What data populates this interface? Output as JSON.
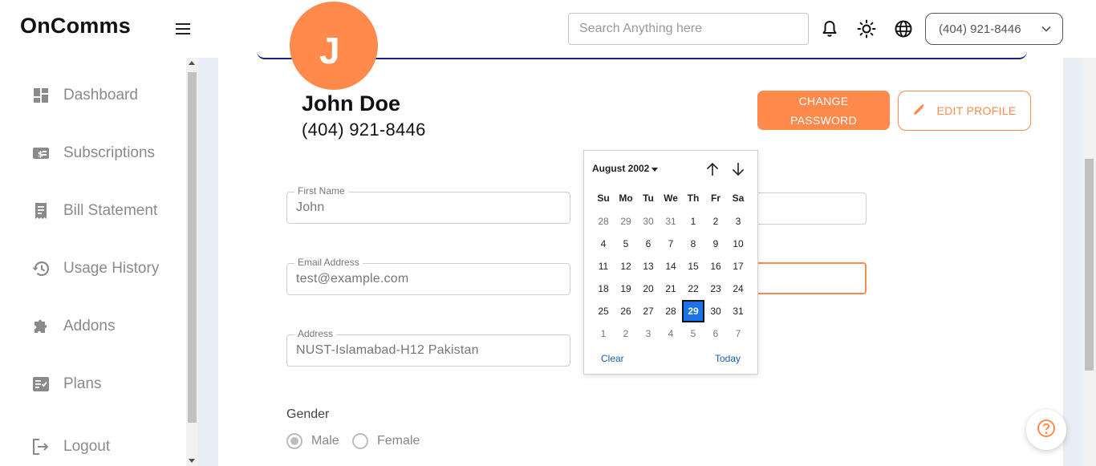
{
  "app": {
    "brand": "OnComms"
  },
  "header": {
    "search_placeholder": "Search Anything here",
    "phone_selected": "(404) 921-8446",
    "icons": [
      "menu-icon",
      "bell-icon",
      "sun-icon",
      "globe-icon",
      "chevron-down-icon"
    ]
  },
  "sidebar": {
    "items": [
      {
        "label": "Dashboard",
        "icon": "dashboard-icon"
      },
      {
        "label": "Subscriptions",
        "icon": "subscriptions-icon"
      },
      {
        "label": "Bill Statement",
        "icon": "receipt-icon"
      },
      {
        "label": "Usage History",
        "icon": "history-icon"
      },
      {
        "label": "Addons",
        "icon": "puzzle-icon"
      },
      {
        "label": "Plans",
        "icon": "plans-icon"
      },
      {
        "label": "Logout",
        "icon": "logout-icon"
      }
    ]
  },
  "profile": {
    "avatar_letter": "J",
    "name": "John Doe",
    "phone": "(404) 921-8446",
    "change_password_line1": "CHANGE",
    "change_password_line2": "PASSWORD",
    "edit_profile_label": "EDIT PROFILE"
  },
  "form": {
    "first_name": {
      "label": "First Name",
      "value": "John"
    },
    "email": {
      "label": "Email Address",
      "value": "test@example.com"
    },
    "address": {
      "label": "Address",
      "value": "NUST-Islamabad-H12 Pakistan"
    },
    "gender": {
      "label": "Gender",
      "options": [
        "Male",
        "Female"
      ],
      "selected": "Male"
    }
  },
  "datepicker": {
    "month_label": "August 2002",
    "weekdays": [
      "Su",
      "Mo",
      "Tu",
      "We",
      "Th",
      "Fr",
      "Sa"
    ],
    "weeks": [
      [
        "28",
        "29",
        "30",
        "31",
        "1",
        "2",
        "3"
      ],
      [
        "4",
        "5",
        "6",
        "7",
        "8",
        "9",
        "10"
      ],
      [
        "11",
        "12",
        "13",
        "14",
        "15",
        "16",
        "17"
      ],
      [
        "18",
        "19",
        "20",
        "21",
        "22",
        "23",
        "24"
      ],
      [
        "25",
        "26",
        "27",
        "28",
        "29",
        "30",
        "31"
      ],
      [
        "1",
        "2",
        "3",
        "4",
        "5",
        "6",
        "7"
      ]
    ],
    "selected_day": "29",
    "clear_label": "Clear",
    "today_label": "Today"
  },
  "colors": {
    "accent": "#ff8a4c",
    "selected_day": "#1a73e8",
    "banner_line": "#1a1f8f"
  }
}
